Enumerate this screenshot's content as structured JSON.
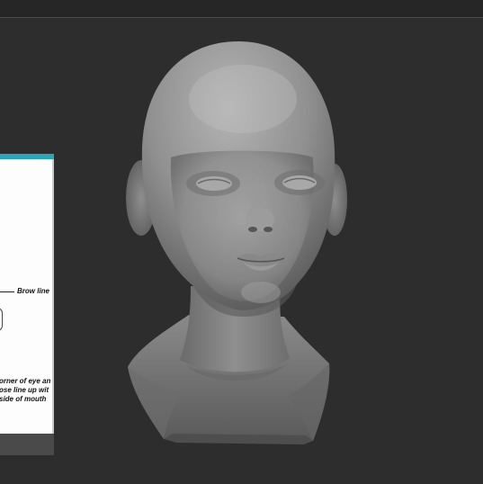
{
  "reference_image": {
    "brow_label": "Brow line",
    "note_lines": [
      "orner of eye an",
      "ose line up wit",
      "side of mouth"
    ]
  },
  "viewport": {
    "background": "#2d2d2d",
    "model_color": "#8e8e8e"
  }
}
